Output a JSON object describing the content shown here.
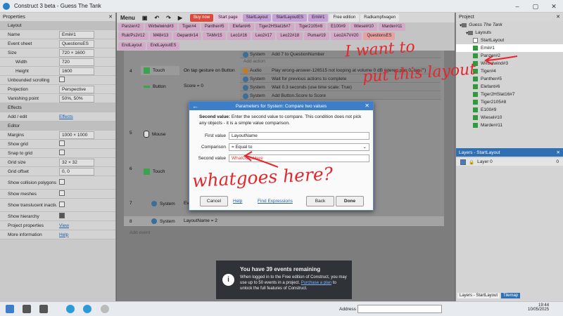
{
  "window": {
    "title": "Construct 3 beta - Guess The Tank"
  },
  "properties": {
    "header": "Properties",
    "rows": [
      {
        "type": "section",
        "label": "Layout"
      },
      {
        "label": "Name",
        "value": "Emil#1"
      },
      {
        "label": "Event sheet",
        "value": "QuestionsES"
      },
      {
        "label": "Size",
        "value": "720 × 1600"
      },
      {
        "label": "Width",
        "value": "720",
        "indent": true
      },
      {
        "label": "Height",
        "value": "1600",
        "indent": true
      },
      {
        "label": "Unbounded scrolling",
        "check": false
      },
      {
        "label": "Projection",
        "value": "Perspective"
      },
      {
        "label": "Vanishing point",
        "value": "50%, 50%"
      },
      {
        "type": "section",
        "label": "Effects"
      },
      {
        "label": "Add / edit",
        "link": "Effects"
      },
      {
        "type": "section",
        "label": "Editor"
      },
      {
        "label": "Margins",
        "value": "1000 × 1000"
      },
      {
        "label": "Show grid",
        "check": false
      },
      {
        "label": "Snap to grid",
        "check": false
      },
      {
        "label": "Grid size",
        "value": "32 × 32"
      },
      {
        "label": "Grid offset",
        "value": "0, 0"
      },
      {
        "label": "Show collision polygons",
        "check": false,
        "tall": true
      },
      {
        "label": "Show meshes",
        "check": false
      },
      {
        "label": "Show translucent inactive layers",
        "check": false,
        "tall": true
      },
      {
        "label": "Show hierarchy",
        "check": true
      },
      {
        "label": "Project properties",
        "link": "View"
      },
      {
        "label": "More information",
        "link": "Help"
      }
    ]
  },
  "toolbar": {
    "menu": "Menu",
    "tabs_row0": [
      "Buy now",
      "Start page",
      "StartLayout",
      "StartLayoutES",
      "Emil#1",
      "Free edition",
      "Radkampfwagen"
    ],
    "tabs_row1": [
      "Panzer#2",
      "Wirbelwind#3",
      "Tiger#4",
      "Panther#5",
      "Elefant#6",
      "Tiger2HSlat16#7",
      "Tiger2105#8",
      "E100#9",
      "Wiesel#10",
      "Marder#11"
    ],
    "tabs_row2": [
      "Ruk/Ps2#12",
      "M48#13",
      "Gepard#14",
      "TAM#15",
      "Leo1#16",
      "Leo2#17",
      "Leo22#18",
      "Puma#19",
      "Leo2A7V#20",
      "QuestionsES"
    ],
    "tabs_row3": [
      "EndLayout",
      "EndLayoutES"
    ]
  },
  "events": {
    "rows": [
      {
        "obj": "System",
        "text": "Add 7 to QuestionNumber"
      },
      {
        "obj": "Audio",
        "text": "Play wrong-answer-126515 not looping at volume 0 dB (stereo pan 0, tag \"\")"
      },
      {
        "obj": "System",
        "text": "Wait for previous actions to complete"
      },
      {
        "obj": "System",
        "text": "Wait 0.3 seconds (use time scale: True)"
      },
      {
        "obj": "System",
        "text": "Add Button.Score to Score"
      }
    ],
    "cond_touch": "Touch",
    "cond_touch_text": "On tap gesture on Button",
    "cond_button": "Button",
    "cond_button_text": "Score = 0",
    "cond_mouse": "Mouse",
    "cond_touch2": "Touch",
    "cond_system": "System",
    "cond_system_ev": "Ev",
    "cond_system2": "System",
    "cond_system2_text": "LayoutName = 2",
    "num4": "4",
    "num5": "5",
    "num6": "6",
    "num7": "7",
    "num8": "8",
    "add_action": "Add action",
    "add_event": "Add event"
  },
  "dialog": {
    "title": "Parameters for System: Compare two values",
    "desc_bold": "Second value:",
    "desc": "Enter the second value to compare. This condition does not pick any objects - it is a simple value comparison.",
    "first_label": "First value",
    "first_value": "LayoutName",
    "comparison_label": "Comparison",
    "comparison_value": "= Equal to",
    "second_label": "Second value",
    "second_value": "WhatGoesHere",
    "cancel": "Cancel",
    "help": "Help",
    "find": "Find Expressions",
    "back": "Back",
    "done": "Done"
  },
  "project": {
    "header": "Project",
    "root": "Guess The Tank",
    "layouts_folder": "Layouts",
    "items": [
      "StartLayout",
      "Emil#1",
      "Panzer#2",
      "Wirbelwind#3",
      "Tiger#4",
      "Panther#5",
      "Elefant#6",
      "Tiger2HSlat16#7",
      "Tiger2105#8",
      "E100#9",
      "Wiesel#10",
      "Marder#11"
    ]
  },
  "layers": {
    "header": "Layers - StartLayout",
    "layer0": "Layer 0",
    "layer0_count": "0",
    "bottom_tab1": "Layers - StartLayout",
    "bottom_tab2": "Tilemap"
  },
  "notification": {
    "title": "You have 39 events remaining",
    "body": "When logged in to the Free edition of Construct, you may use up to 50 events in a project.",
    "link": "Purchase a plan",
    "tail": "to unlock the full features of Construct."
  },
  "annotations": {
    "top": "I want to",
    "top2": "put this layout",
    "middle": "whatgoes here?"
  },
  "taskbar": {
    "address_label": "Address",
    "time": "19:44",
    "date": "10/05/2025"
  }
}
